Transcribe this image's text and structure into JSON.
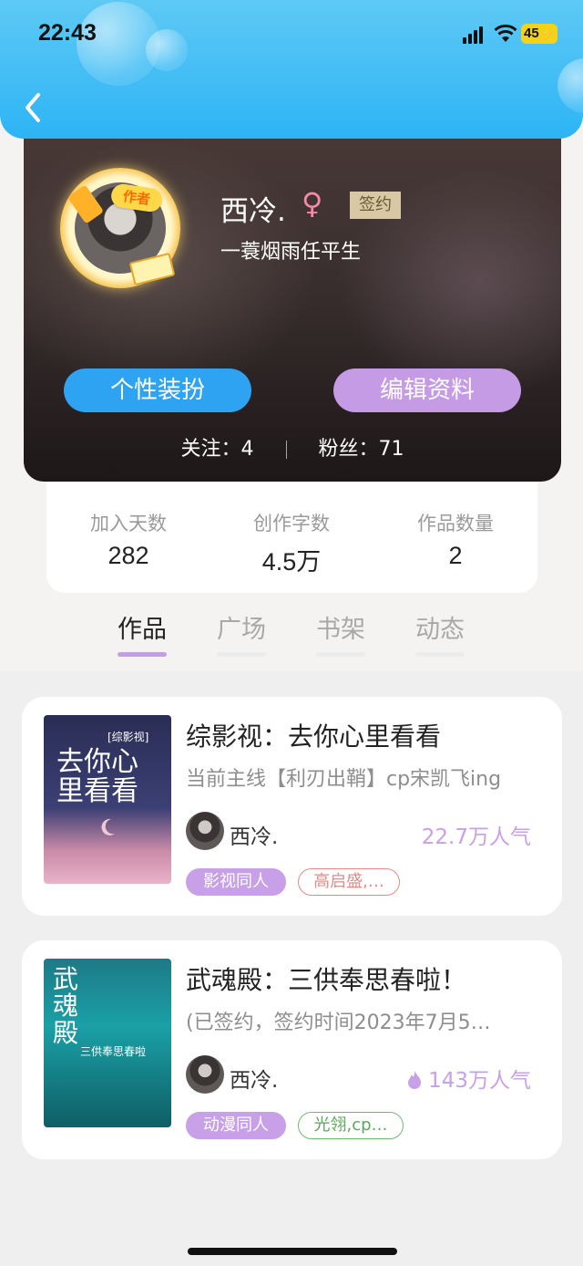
{
  "status": {
    "time": "22:43",
    "battery": "45"
  },
  "profile": {
    "name": "西冷.",
    "gender_symbol": "♀",
    "signed_badge": "签约",
    "author_badge": "作者",
    "motto": "一蓑烟雨任平生",
    "dress_button": "个性装扮",
    "edit_button": "编辑资料",
    "follow_label": "关注：4",
    "fans_label": "粉丝：71"
  },
  "stats": [
    {
      "label": "加入天数",
      "value": "282"
    },
    {
      "label": "创作字数",
      "value": "4.5万"
    },
    {
      "label": "作品数量",
      "value": "2"
    }
  ],
  "tabs": [
    "作品",
    "广场",
    "书架",
    "动态"
  ],
  "active_tab": "作品",
  "works": [
    {
      "title": "综影视：去你心里看看",
      "desc": "当前主线【利刃出鞘】cp宋凯飞ing",
      "cover_text": "去你心里看看",
      "cover_sub": "[综影视]",
      "author": "西冷.",
      "popularity": "22.7万人气",
      "tag_category": "影视同人",
      "tag_cp": "高启盛,…"
    },
    {
      "title": "武魂殿：三供奉思春啦！",
      "desc": "(已签约，签约时间2023年7月5…",
      "cover_text": "武魂殿",
      "cover_sub": "三供奉思春啦",
      "author": "西冷.",
      "popularity": "143万人气",
      "tag_category": "动漫同人",
      "tag_cp": "光翎,cp…"
    }
  ],
  "colors": {
    "topbar": "#2db4f5",
    "dress_button": "#2ea3f2",
    "edit_button": "#c59be6",
    "accent_purple": "#c7a0e8",
    "signed_badge": "#d8c9a4"
  }
}
